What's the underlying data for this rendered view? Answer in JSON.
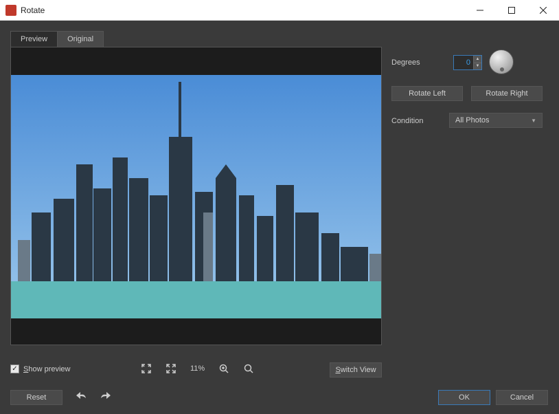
{
  "window": {
    "title": "Rotate"
  },
  "tabs": {
    "preview": "Preview",
    "original": "Original",
    "active": "preview"
  },
  "controls": {
    "degrees_label": "Degrees",
    "degrees_value": "0",
    "rotate_left": "Rotate Left",
    "rotate_right": "Rotate Right",
    "condition_label": "Condition",
    "condition_value": "All Photos"
  },
  "toolbar": {
    "show_preview": "Show preview",
    "show_preview_checked": true,
    "zoom_percent": "11%",
    "switch_view": "Switch View"
  },
  "footer": {
    "reset": "Reset",
    "ok": "OK",
    "cancel": "Cancel"
  },
  "preview": {
    "description": "City skyline with tall skyscrapers against a clear blue sky over teal water"
  }
}
